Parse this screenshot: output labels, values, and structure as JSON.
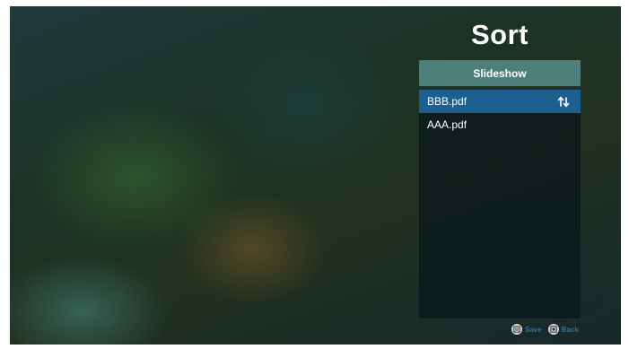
{
  "panel": {
    "title": "Sort",
    "mode_button_label": "Slideshow"
  },
  "files": [
    {
      "name": "BBB.pdf",
      "selected": true
    },
    {
      "name": "AAA.pdf",
      "selected": false
    }
  ],
  "footer": {
    "save_label": "Save",
    "back_label": "Back"
  },
  "icons": {
    "sort": "sort-arrows-icon",
    "save": "save-key-icon",
    "back": "back-key-icon"
  },
  "colors": {
    "selected_row": "#1d5f8f",
    "mode_button": "#4e7f7b",
    "footer_text": "#2f6f9f"
  }
}
